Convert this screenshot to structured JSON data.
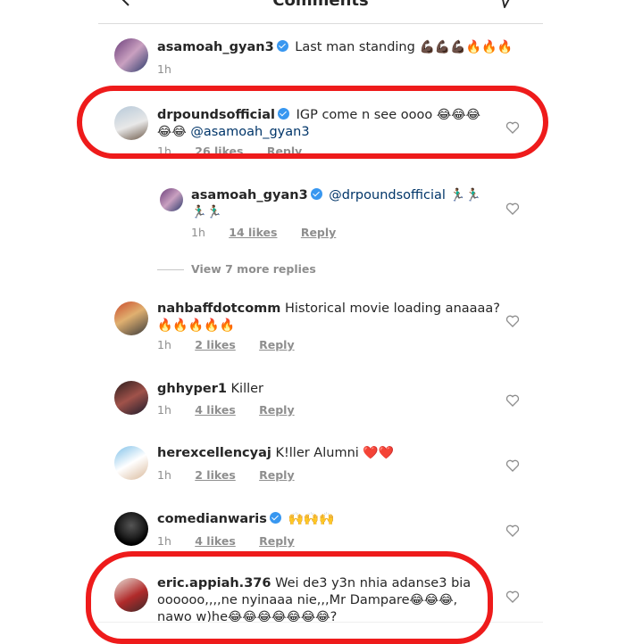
{
  "header": {
    "title": "Comments"
  },
  "comments": [
    {
      "username": "asamoah_gyan3",
      "verified": true,
      "text": "Last man standing",
      "emoji": "💪🏿💪🏿💪🏿🔥🔥🔥",
      "time": "1h",
      "likes": "",
      "reply": ""
    },
    {
      "username": "drpoundsofficial",
      "verified": true,
      "text": "IGP come n see oooo",
      "emoji": "😂😂😂",
      "line2_emoji": "😂😂",
      "mention": "@asamoah_gyan3",
      "time": "1h",
      "likes": "26 likes",
      "reply": "Reply"
    },
    {
      "username": "asamoah_gyan3",
      "verified": true,
      "mention": "@drpoundsofficial",
      "emoji": "🏃🏾‍♂️🏃🏾‍♂️",
      "line2_emoji": "🏃🏾‍♂️🏃🏾‍♂️",
      "time": "1h",
      "likes": "14 likes",
      "reply": "Reply"
    },
    {
      "username": "nahbaffdotcomm",
      "text": "Historical movie loading anaaaa?",
      "line2_emoji": "🔥🔥🔥🔥🔥",
      "time": "1h",
      "likes": "2 likes",
      "reply": "Reply"
    },
    {
      "username": "ghhyper1",
      "text": "Killer",
      "time": "1h",
      "likes": "4 likes",
      "reply": "Reply"
    },
    {
      "username": "herexcellencyaj",
      "text": "K!ller Alumni",
      "emoji": "❤️❤️",
      "time": "1h",
      "likes": "2 likes",
      "reply": "Reply"
    },
    {
      "username": "comedianwaris",
      "verified": true,
      "emoji": "🙌🙌🙌",
      "time": "1h",
      "likes": "4 likes",
      "reply": "Reply"
    },
    {
      "username": "eric.appiah.376",
      "text": "Wei de3 y3n nhia adanse3 bia",
      "line2": "oooooo,,,,ne nyinaaa nie,,,Mr Dampare",
      "line2_emoji": "😂😂😂,",
      "line3": "nawo w)he",
      "line3_emoji": "😂😂😂😂😂😂😂",
      "line3_end": "?"
    }
  ],
  "view_more_replies": "View 7 more replies",
  "colors": {
    "highlight": "#ee1b1b",
    "verified": "#3897f0",
    "mention": "#003569",
    "meta": "#8e8e8e"
  }
}
